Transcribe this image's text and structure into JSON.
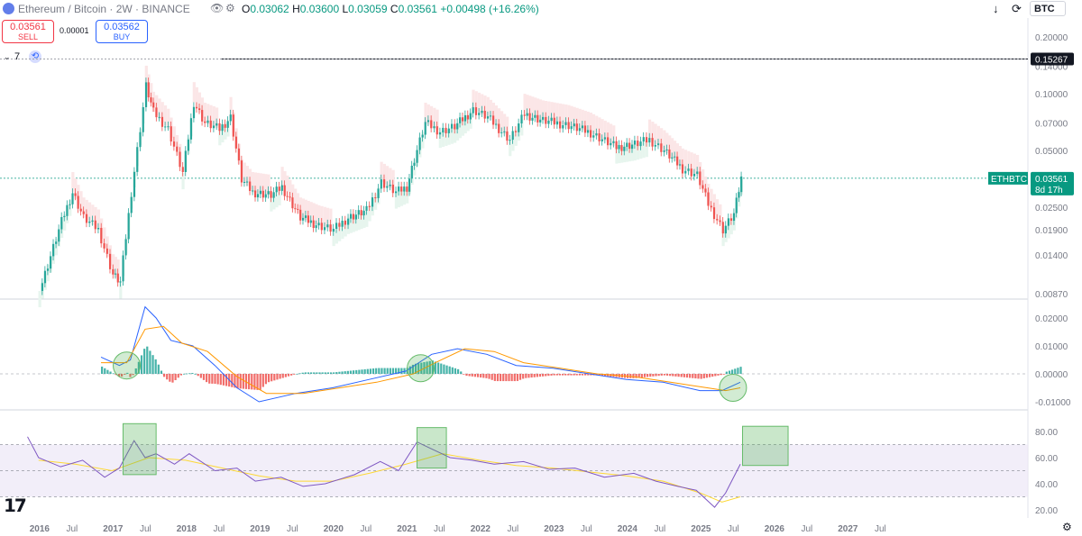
{
  "header": {
    "symbol_title": "Ethereum / Bitcoin · 2W · BINANCE",
    "ohlc": {
      "o_key": "O",
      "o": "0.03062",
      "h_key": "H",
      "h": "0.03600",
      "l_key": "L",
      "l": "0.03059",
      "c_key": "C",
      "c": "0.03561",
      "change": "+0.00498 (+16.26%)"
    },
    "currency": "BTC"
  },
  "trade": {
    "sell_price": "0.03561",
    "sell_label": "SELL",
    "spread": "0.00001",
    "buy_price": "0.03562",
    "buy_label": "BUY"
  },
  "indicators_count": "7",
  "colors": {
    "up": "#26a69a",
    "down": "#ef5350",
    "macd": "#2962ff",
    "signal": "#ff9800",
    "rsi": "#7e57c2",
    "rsi_ma": "#fdd835"
  },
  "chart_data": [
    {
      "type": "candlestick",
      "name": "ETHBTC",
      "scale": "log",
      "y_ticks": [
        "0.20000",
        "0.14000",
        "0.10000",
        "0.07000",
        "0.05000",
        "0.03561",
        "0.02500",
        "0.01900",
        "0.01400",
        "0.00870"
      ],
      "high_line": {
        "label": "0.15267",
        "value": 0.15267
      },
      "price_label": {
        "symbol": "ETHBTC",
        "value": "0.03561",
        "countdown": "8d 17h"
      },
      "x_labels": [
        "2016",
        "Jul",
        "2017",
        "Jul",
        "2018",
        "Jul",
        "2019",
        "Jul",
        "2020",
        "Jul",
        "2021",
        "Jul",
        "2022",
        "Jul",
        "2023",
        "Jul",
        "2024",
        "Jul",
        "2025",
        "Jul",
        "2026",
        "Jul",
        "2027",
        "Jul"
      ],
      "approx_close_path": [
        [
          2016.0,
          0.009
        ],
        [
          2016.3,
          0.021
        ],
        [
          2016.45,
          0.03
        ],
        [
          2016.6,
          0.022
        ],
        [
          2016.8,
          0.019
        ],
        [
          2017.0,
          0.011
        ],
        [
          2017.1,
          0.01
        ],
        [
          2017.25,
          0.03
        ],
        [
          2017.45,
          0.11
        ],
        [
          2017.55,
          0.08
        ],
        [
          2017.75,
          0.065
        ],
        [
          2017.95,
          0.038
        ],
        [
          2018.1,
          0.09
        ],
        [
          2018.25,
          0.07
        ],
        [
          2018.45,
          0.065
        ],
        [
          2018.6,
          0.075
        ],
        [
          2018.75,
          0.035
        ],
        [
          2018.9,
          0.03
        ],
        [
          2019.15,
          0.029
        ],
        [
          2019.3,
          0.032
        ],
        [
          2019.55,
          0.022
        ],
        [
          2019.8,
          0.02
        ],
        [
          2020.0,
          0.019
        ],
        [
          2020.2,
          0.022
        ],
        [
          2020.45,
          0.024
        ],
        [
          2020.65,
          0.034
        ],
        [
          2020.85,
          0.03
        ],
        [
          2021.0,
          0.032
        ],
        [
          2021.1,
          0.045
        ],
        [
          2021.25,
          0.07
        ],
        [
          2021.45,
          0.063
        ],
        [
          2021.65,
          0.067
        ],
        [
          2021.9,
          0.082
        ],
        [
          2022.1,
          0.075
        ],
        [
          2022.4,
          0.057
        ],
        [
          2022.6,
          0.078
        ],
        [
          2022.85,
          0.072
        ],
        [
          2023.2,
          0.068
        ],
        [
          2023.5,
          0.062
        ],
        [
          2023.85,
          0.052
        ],
        [
          2024.1,
          0.054
        ],
        [
          2024.3,
          0.057
        ],
        [
          2024.5,
          0.05
        ],
        [
          2024.75,
          0.04
        ],
        [
          2024.95,
          0.037
        ],
        [
          2025.1,
          0.026
        ],
        [
          2025.3,
          0.019
        ],
        [
          2025.45,
          0.023
        ],
        [
          2025.55,
          0.0356
        ]
      ]
    },
    {
      "type": "line",
      "name": "MACD",
      "y_ticks": [
        "0.02000",
        "0.01000",
        "0.00000",
        "-0.01000"
      ],
      "series": [
        {
          "values": [
            [
              2016.85,
              0.006
            ],
            [
              2017.1,
              0.003
            ],
            [
              2017.25,
              0.005
            ],
            [
              2017.45,
              0.024
            ],
            [
              2017.6,
              0.02
            ],
            [
              2017.8,
              0.012
            ],
            [
              2018.1,
              0.01
            ],
            [
              2018.4,
              0.003
            ],
            [
              2018.7,
              -0.005
            ],
            [
              2019.0,
              -0.01
            ],
            [
              2019.5,
              -0.007
            ],
            [
              2020.0,
              -0.005
            ],
            [
              2020.5,
              -0.002
            ],
            [
              2021.0,
              0.001
            ],
            [
              2021.35,
              0.007
            ],
            [
              2021.7,
              0.009
            ],
            [
              2022.1,
              0.007
            ],
            [
              2022.5,
              0.003
            ],
            [
              2023.0,
              0.002
            ],
            [
              2023.5,
              0.0
            ],
            [
              2024.0,
              -0.002
            ],
            [
              2024.5,
              -0.003
            ],
            [
              2025.0,
              -0.006
            ],
            [
              2025.3,
              -0.006
            ],
            [
              2025.55,
              -0.003
            ]
          ]
        },
        {
          "values": [
            [
              2016.85,
              0.004
            ],
            [
              2017.2,
              0.004
            ],
            [
              2017.45,
              0.016
            ],
            [
              2017.7,
              0.017
            ],
            [
              2017.95,
              0.011
            ],
            [
              2018.3,
              0.008
            ],
            [
              2018.7,
              -0.001
            ],
            [
              2019.1,
              -0.007
            ],
            [
              2019.6,
              -0.007
            ],
            [
              2020.1,
              -0.005
            ],
            [
              2020.6,
              -0.003
            ],
            [
              2021.1,
              0.0
            ],
            [
              2021.4,
              0.004
            ],
            [
              2021.8,
              0.009
            ],
            [
              2022.2,
              0.008
            ],
            [
              2022.6,
              0.004
            ],
            [
              2023.1,
              0.002
            ],
            [
              2023.6,
              0.0
            ],
            [
              2024.1,
              -0.001
            ],
            [
              2024.6,
              -0.003
            ],
            [
              2025.1,
              -0.005
            ],
            [
              2025.35,
              -0.006
            ],
            [
              2025.55,
              -0.005
            ]
          ]
        }
      ]
    },
    {
      "type": "line",
      "name": "RSI",
      "y_ticks": [
        "80.00",
        "60.00",
        "40.00",
        "20.00"
      ],
      "levels": [
        70,
        50,
        30
      ],
      "series": [
        {
          "values": [
            [
              2015.85,
              76
            ],
            [
              2016.0,
              60
            ],
            [
              2016.3,
              53
            ],
            [
              2016.6,
              58
            ],
            [
              2016.9,
              45
            ],
            [
              2017.1,
              52
            ],
            [
              2017.3,
              73
            ],
            [
              2017.45,
              60
            ],
            [
              2017.6,
              63
            ],
            [
              2017.85,
              55
            ],
            [
              2018.05,
              63
            ],
            [
              2018.4,
              50
            ],
            [
              2018.7,
              52
            ],
            [
              2018.95,
              42
            ],
            [
              2019.3,
              45
            ],
            [
              2019.6,
              38
            ],
            [
              2019.9,
              40
            ],
            [
              2020.3,
              47
            ],
            [
              2020.65,
              57
            ],
            [
              2020.9,
              50
            ],
            [
              2021.15,
              72
            ],
            [
              2021.3,
              68
            ],
            [
              2021.6,
              60
            ],
            [
              2021.9,
              58
            ],
            [
              2022.2,
              55
            ],
            [
              2022.6,
              57
            ],
            [
              2022.95,
              51
            ],
            [
              2023.3,
              52
            ],
            [
              2023.7,
              45
            ],
            [
              2024.1,
              48
            ],
            [
              2024.4,
              42
            ],
            [
              2024.7,
              38
            ],
            [
              2024.95,
              35
            ],
            [
              2025.2,
              22
            ],
            [
              2025.35,
              33
            ],
            [
              2025.55,
              55
            ]
          ]
        },
        {
          "values": [
            [
              2016.0,
              58
            ],
            [
              2016.5,
              55
            ],
            [
              2017.0,
              50
            ],
            [
              2017.5,
              60
            ],
            [
              2018.0,
              58
            ],
            [
              2018.5,
              52
            ],
            [
              2019.0,
              46
            ],
            [
              2019.5,
              42
            ],
            [
              2020.0,
              42
            ],
            [
              2020.5,
              48
            ],
            [
              2021.0,
              55
            ],
            [
              2021.5,
              63
            ],
            [
              2022.0,
              58
            ],
            [
              2022.5,
              54
            ],
            [
              2023.0,
              52
            ],
            [
              2023.5,
              49
            ],
            [
              2024.0,
              46
            ],
            [
              2024.5,
              42
            ],
            [
              2025.0,
              33
            ],
            [
              2025.3,
              26
            ],
            [
              2025.55,
              30
            ]
          ]
        }
      ]
    }
  ]
}
